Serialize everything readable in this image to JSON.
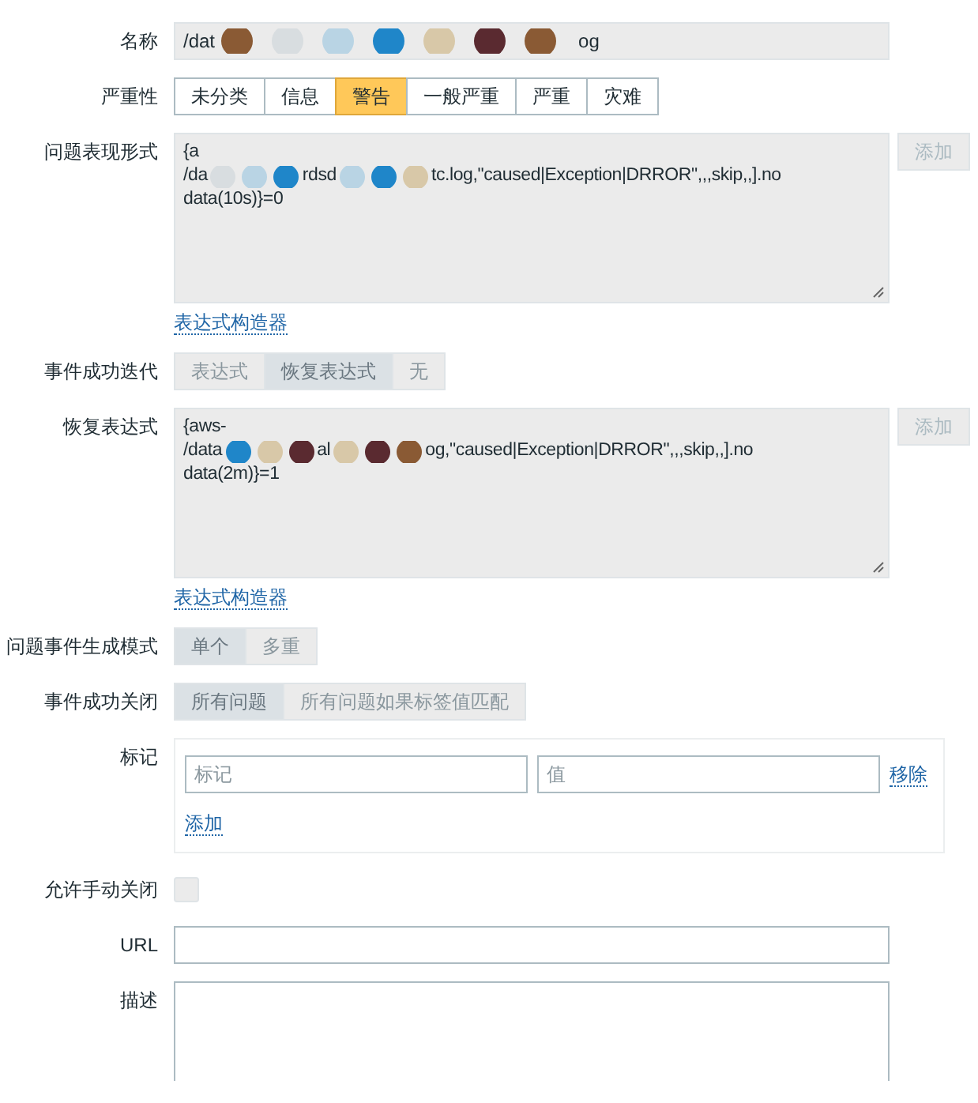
{
  "form": {
    "name": {
      "label": "名称",
      "segments": [
        "/dat",
        "og"
      ]
    },
    "severity": {
      "label": "严重性",
      "options": [
        {
          "label": "未分类",
          "selected": false
        },
        {
          "label": "信息",
          "selected": false
        },
        {
          "label": "警告",
          "selected": true
        },
        {
          "label": "一般严重",
          "selected": false
        },
        {
          "label": "严重",
          "selected": false
        },
        {
          "label": "灾难",
          "selected": false
        }
      ]
    },
    "problem_expression": {
      "label": "问题表现形式",
      "lines": [
        [
          "{a"
        ],
        [
          "/da",
          "rdsd",
          "tc.log,\"caused|Exception|DRROR\",,,skip,,].no"
        ],
        [
          "data(10s)}=0"
        ]
      ],
      "add_button": "添加",
      "disabled": true,
      "builder_link": "表达式构造器"
    },
    "recovery_mode": {
      "label": "事件成功迭代",
      "disabled": true,
      "options": [
        {
          "label": "表达式",
          "selected": false
        },
        {
          "label": "恢复表达式",
          "selected": true
        },
        {
          "label": "无",
          "selected": false
        }
      ]
    },
    "recovery_expression": {
      "label": "恢复表达式",
      "lines": [
        [
          "{aws-"
        ],
        [
          "/data",
          "al",
          "og,\"caused|Exception|DRROR\",,,skip,,].no"
        ],
        [
          "data(2m)}=1"
        ]
      ],
      "add_button": "添加",
      "disabled": true,
      "builder_link": "表达式构造器"
    },
    "generation_mode": {
      "label": "问题事件生成模式",
      "disabled": true,
      "options": [
        {
          "label": "单个",
          "selected": true
        },
        {
          "label": "多重",
          "selected": false
        }
      ]
    },
    "ok_closes": {
      "label": "事件成功关闭",
      "disabled": true,
      "options": [
        {
          "label": "所有问题",
          "selected": true
        },
        {
          "label": "所有问题如果标签值匹配",
          "selected": false
        }
      ]
    },
    "tags": {
      "label": "标记",
      "rows": [
        {
          "tag_placeholder": "标记",
          "value_placeholder": "值",
          "remove": "移除"
        }
      ],
      "add": "添加"
    },
    "manual_close": {
      "label": "允许手动关闭",
      "checked": false,
      "disabled": true
    },
    "url": {
      "label": "URL"
    },
    "description": {
      "label": "描述"
    }
  }
}
